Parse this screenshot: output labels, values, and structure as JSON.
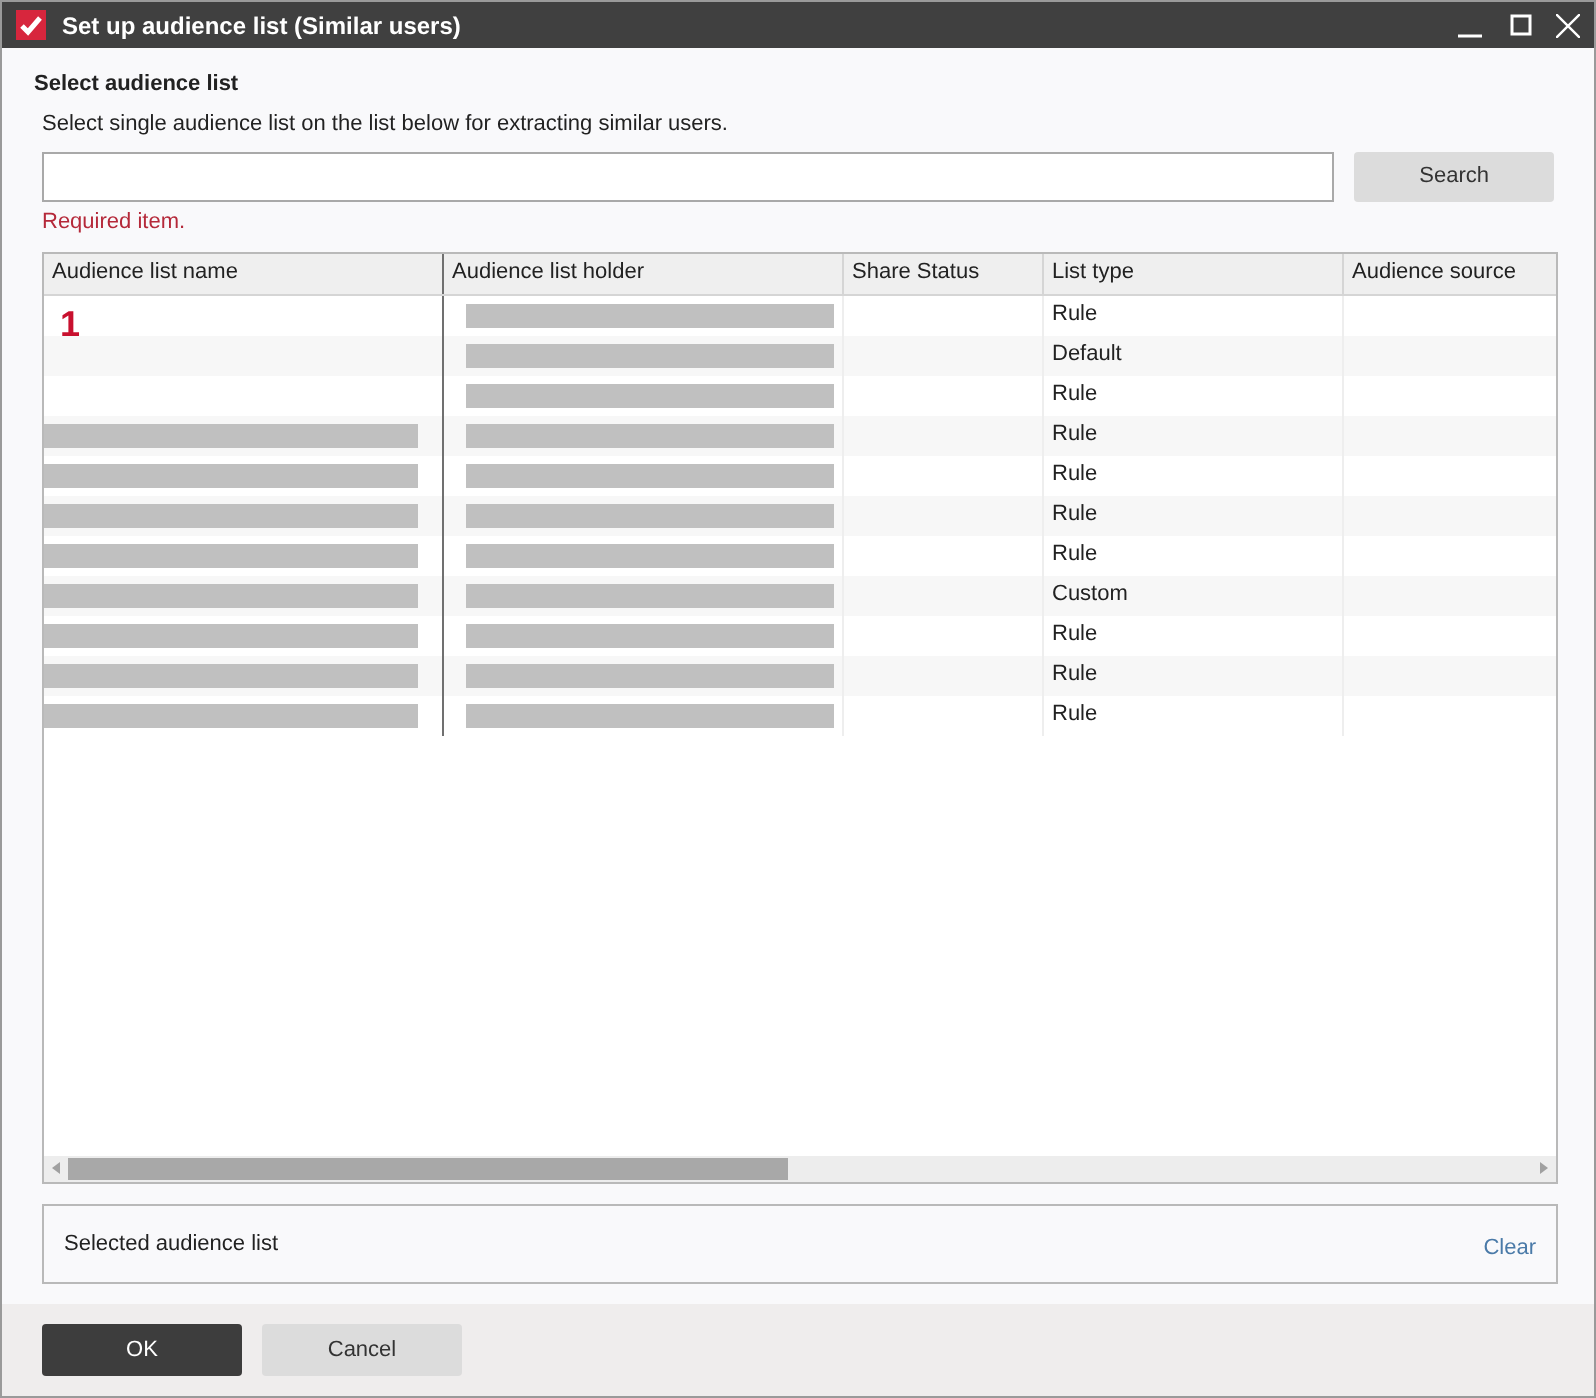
{
  "window": {
    "title": "Set up audience list (Similar users)"
  },
  "heading": "Select audience list",
  "instruction": "Select single audience list on the list below for extracting similar users.",
  "search": {
    "button": "Search",
    "error": "Required item."
  },
  "table": {
    "columns": [
      "Audience list name",
      "Audience list holder",
      "Share Status",
      "List type",
      "Audience source"
    ],
    "marker": "1",
    "rows": [
      {
        "name_redacted": false,
        "holder_redacted": true,
        "list_type": "Rule"
      },
      {
        "name_redacted": false,
        "holder_redacted": true,
        "list_type": "Default"
      },
      {
        "name_redacted": false,
        "holder_redacted": true,
        "list_type": "Rule"
      },
      {
        "name_redacted": true,
        "holder_redacted": true,
        "list_type": "Rule"
      },
      {
        "name_redacted": true,
        "holder_redacted": true,
        "list_type": "Rule"
      },
      {
        "name_redacted": true,
        "holder_redacted": true,
        "list_type": "Rule"
      },
      {
        "name_redacted": true,
        "holder_redacted": true,
        "list_type": "Rule"
      },
      {
        "name_redacted": true,
        "holder_redacted": true,
        "list_type": "Custom"
      },
      {
        "name_redacted": true,
        "holder_redacted": true,
        "list_type": "Rule"
      },
      {
        "name_redacted": true,
        "holder_redacted": true,
        "list_type": "Rule"
      },
      {
        "name_redacted": true,
        "holder_redacted": true,
        "list_type": "Rule"
      }
    ]
  },
  "selected_panel": {
    "label": "Selected audience list",
    "clear": "Clear"
  },
  "buttons": {
    "ok": "OK",
    "cancel": "Cancel"
  }
}
